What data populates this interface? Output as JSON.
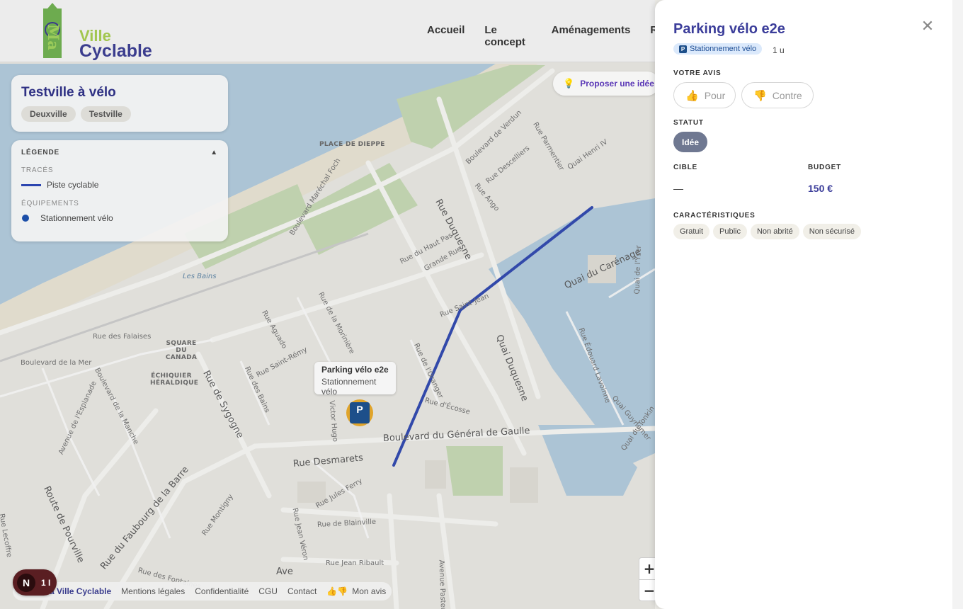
{
  "header": {
    "logo": {
      "ma": "Ma",
      "ville": "Ville",
      "cyclable": "Cyclable"
    },
    "nav": [
      "Accueil",
      "Le concept",
      "Aménagements",
      "R"
    ]
  },
  "city_card": {
    "title": "Testville à vélo",
    "chips": [
      "Deuxville",
      "Testville"
    ]
  },
  "legend": {
    "title": "LÉGENDE",
    "toggle": "▲",
    "section_traces": "TRACÉS",
    "trace_label": "Piste cyclable",
    "section_equipements": "ÉQUIPEMENTS",
    "equip_label": "Stationnement vélo",
    "colors": {
      "trace": "#2b45b0",
      "equip": "#1b4ea8"
    }
  },
  "propose_button": {
    "icon": "lightbulb-icon",
    "label": "Proposer une idée"
  },
  "map": {
    "labels": [
      "PLACE DE DIEPPE",
      "Boulevard Maréchal Foch",
      "Boulevard de Verdun",
      "Rue Parmentier",
      "Quai Henri IV",
      "Rue Descelliers",
      "Rue Ango",
      "Rue Duquesne",
      "Rue du Haut Pas",
      "Grande Rue",
      "Quai du Carénage",
      "Les Bains",
      "Rue Saint-Jean",
      "Quai Duquesne",
      "Rue des Falaises",
      "SQUARE DU CANADA",
      "Boulevard de la Mer",
      "Rue Aguado",
      "Rue de la Morinière",
      "Rue Saint-Rémy",
      "Rue de Sygogne",
      "ÉCHIQUIER HÉRALDIQUE",
      "Rue des Bains",
      "Rue de l'Oranger",
      "Rue d'Écosse",
      "Quai de l'Yser",
      "Rue Édouard Lavoinne",
      "Quai Guynemer",
      "Quai du Tonkin",
      "Avenue de l'Esplanade",
      "Boulevard de la Manche",
      "Victor Hugo",
      "Boulevard du Général de Gaulle",
      "Rue Desmarets",
      "Rue Jules Ferry",
      "Route de Pourville",
      "Rue du Faubourg de la Barre",
      "Rue Montigny",
      "Rue Jean Véron",
      "Rue de Blainville",
      "Rue Jean Ribault",
      "Avenue Pasteur",
      "Rue des Fontaines",
      "Rue Lecoffre",
      "Ave"
    ]
  },
  "popup": {
    "title": "Parking vélo e2e",
    "subtitle": "Stationnement vélo"
  },
  "marker": {
    "icon": "bike-parking-icon",
    "letter": "P"
  },
  "footer": {
    "avatar_letter": "N",
    "avatar_count": "1 I",
    "links": [
      "Ma Ville Cyclable",
      "Mentions légales",
      "Confidentialité",
      "CGU",
      "Contact",
      "👍👎",
      "Mon avis"
    ]
  },
  "zoom": {
    "in": "+",
    "out": "−"
  },
  "panel": {
    "title": "Parking vélo e2e",
    "close_icon": "close-icon",
    "badge": {
      "icon_letter": "P",
      "label": "Stationnement vélo"
    },
    "quantity": "1 u",
    "votre_avis_label": "VOTRE AVIS",
    "vote_pour": "Pour",
    "vote_contre": "Contre",
    "statut_label": "STATUT",
    "statut_value": "Idée",
    "cible_label": "CIBLE",
    "cible_value": "—",
    "budget_label": "BUDGET",
    "budget_value": "150 €",
    "caracteristiques_label": "CARACTÉRISTIQUES",
    "tags": [
      "Gratuit",
      "Public",
      "Non abrité",
      "Non sécurisé"
    ]
  },
  "colors": {
    "accent": "#3b3d9a",
    "purple_button": "#5a37b6",
    "status_pill": "#6f7891",
    "budget": "#3b3d9a",
    "route": "#2b45b0",
    "marker_ring": "#e0a42a",
    "marker_fill": "#1d4f8a"
  }
}
